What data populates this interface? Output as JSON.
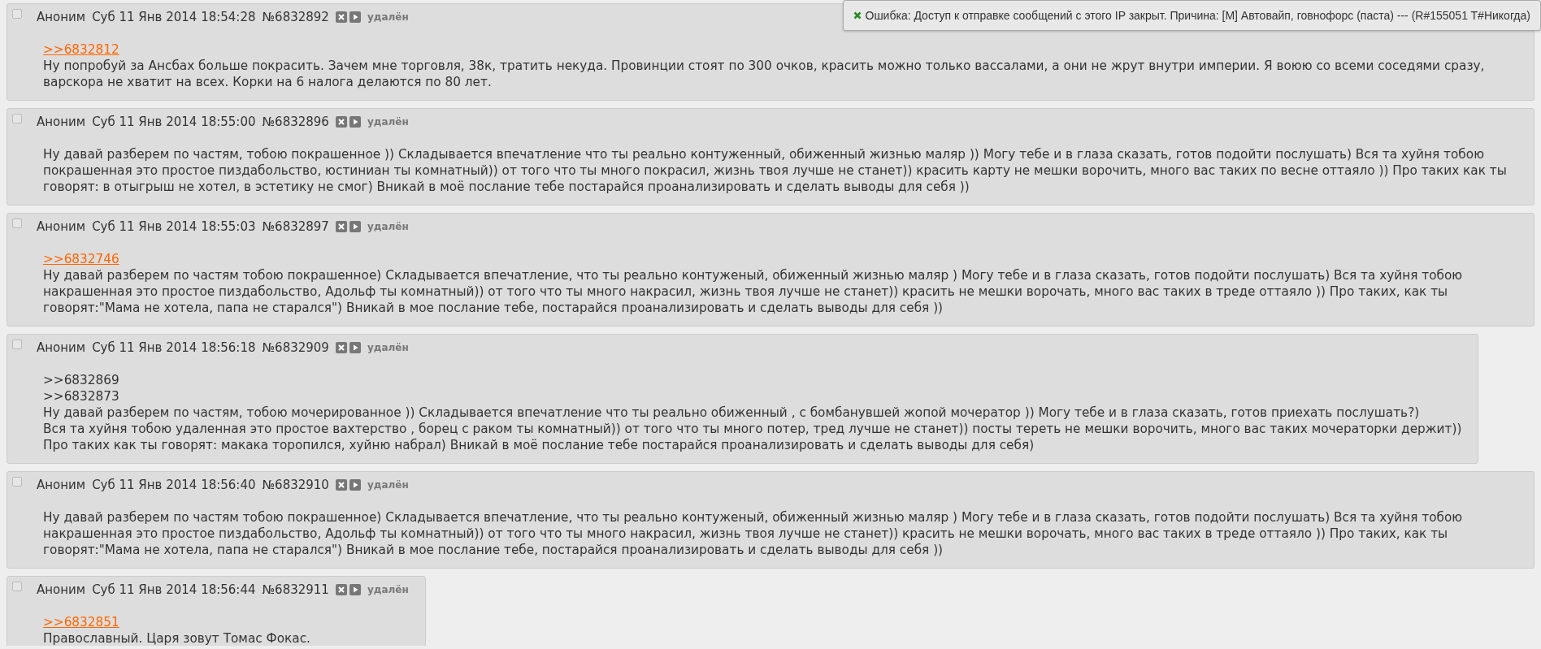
{
  "posts": [
    {
      "checked": false,
      "name": "Аноним",
      "date": "Суб 11 Янв 2014 18:54:28",
      "number": "№6832892",
      "status": "удалён",
      "body": [
        {
          "kind": "reply_link",
          "text": ">>6832812"
        },
        {
          "kind": "text",
          "text": "Ну попробуй за Ансбах больше покрасить. Зачем мне торговля, 38к, тратить некуда. Провинции стоят по 300 очков, красить можно только вассалами, а они не жрут внутри империи. Я воюю со всеми соседями сразу, варскора не хватит на всех. Корки на 6 налога делаются по 80 лет."
        }
      ]
    },
    {
      "checked": false,
      "name": "Аноним",
      "date": "Суб 11 Янв 2014 18:55:00",
      "number": "№6832896",
      "status": "удалён",
      "body": [
        {
          "kind": "text",
          "text": "Ну давай разберем по частям, тобою покрашенное )) Складывается впечатление что ты реально контуженный, обиженный жизнью маляр )) Могу тебе и в глаза сказать, готов подойти послушать) Вся та хуйня тобою покрашенная это простое пиздабольство, юстиниан ты комнатный)) от того что ты много покрасил, жизнь твоя лучше не станет)) красить карту не мешки ворочить, много вас таких по весне оттаяло )) Про таких как ты говорят: в отыгрыш не хотел, в эстетику не смог) Вникай в моё послание тебе постарайся проанализировать и сделать выводы для себя ))"
        }
      ]
    },
    {
      "checked": false,
      "name": "Аноним",
      "date": "Суб 11 Янв 2014 18:55:03",
      "number": "№6832897",
      "status": "удалён",
      "body": [
        {
          "kind": "reply_link",
          "text": ">>6832746"
        },
        {
          "kind": "text",
          "text": "Ну давай разберем по частям тобою покрашенное) Складывается впечатление, что ты реально контуженый, обиженный жизнью маляр ) Могу тебе и в глаза сказать, готов подойти послушать) Вся та хуйня тобою накрашенная это простое пиздабольство, Адольф ты комнатный)) от того что ты много накрасил, жизнь твоя лучше не станет)) красить не мешки ворочать, много вас таких в треде оттаяло )) Про таких, как ты говорят:\"Мама не хотела, папа не старался\") Вникай в мое послание тебе, постарайся проанализировать и сделать выводы для себя ))"
        }
      ]
    },
    {
      "checked": false,
      "name": "Аноним",
      "date": "Суб 11 Янв 2014 18:56:18",
      "number": "№6832909",
      "status": "удалён",
      "body": [
        {
          "kind": "text",
          "text": ">>6832869"
        },
        {
          "kind": "text",
          "text": ">>6832873"
        },
        {
          "kind": "text",
          "text": "Ну давай разберем по частям, тобою мочерированное )) Складывается впечатление что ты реально обиженный , с бомбанувшей жопой мочератор )) Могу тебе и в глаза сказать, готов приехать послушать?)"
        },
        {
          "kind": "text",
          "text": "Вся та хуйня тобою удаленная это простое вахтерство , борец с раком ты комнатный)) от того что ты много потер, тред лучше не станет)) посты тереть не мешки ворочить, много вас таких мочераторки держит))"
        },
        {
          "kind": "text",
          "text": "Про таких как ты говорят: макака торопился, хуйню набрал) Вникай в моё послание тебе постарайся проанализировать и сделать выводы для себя)"
        }
      ]
    },
    {
      "checked": false,
      "name": "Аноним",
      "date": "Суб 11 Янв 2014 18:56:40",
      "number": "№6832910",
      "status": "удалён",
      "body": [
        {
          "kind": "text",
          "text": "Ну давай разберем по частям тобою покрашенное) Складывается впечатление, что ты реально контуженый, обиженный жизнью маляр ) Могу тебе и в глаза сказать, готов подойти послушать) Вся та хуйня тобою накрашенная это простое пиздабольство, Адольф ты комнатный)) от того что ты много накрасил, жизнь твоя лучше не станет)) красить не мешки ворочать, много вас таких в треде оттаяло )) Про таких, как ты говорят:\"Мама не хотела, папа не старался\") Вникай в мое послание тебе, постарайся проанализировать и сделать выводы для себя ))"
        }
      ]
    },
    {
      "checked": false,
      "name": "Аноним",
      "date": "Суб 11 Янв 2014 18:56:44",
      "number": "№6832911",
      "status": "удалён",
      "body": [
        {
          "kind": "reply_link",
          "text": ">>6832851"
        },
        {
          "kind": "text",
          "text": "Православный. Царя зовут Томас Фокас."
        }
      ]
    }
  ],
  "error": {
    "message": "Ошибка: Доступ к отправке сообщений с этого IP закрыт. Причина: [M] Автовайп, говнофорс (паста) --- (R#155051 T#Никогда)"
  }
}
